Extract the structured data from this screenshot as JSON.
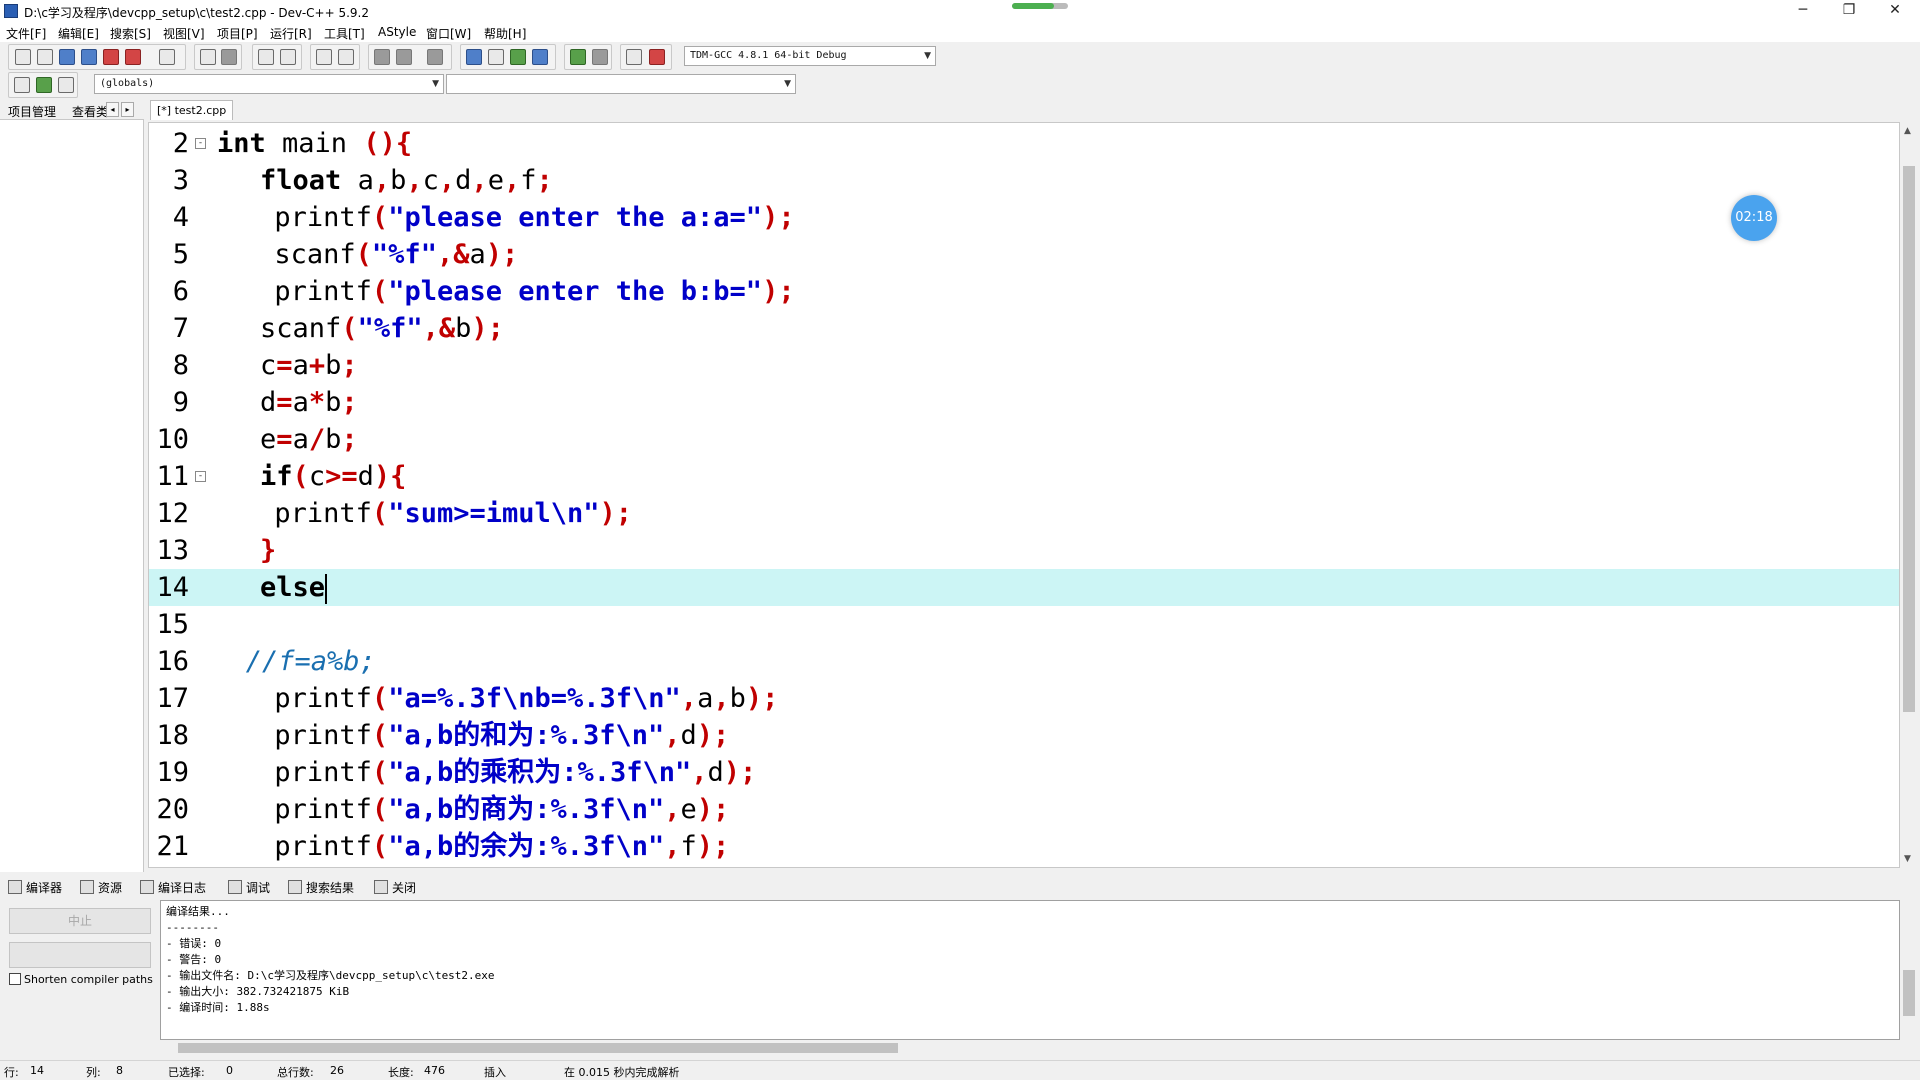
{
  "window": {
    "title": "D:\\c学习及程序\\devcpp_setup\\c\\test2.cpp - Dev-C++ 5.9.2",
    "progress_fraction": 0.75,
    "minimize": "─",
    "restore": "❐",
    "close": "✕"
  },
  "menu": [
    "文件[F]",
    "编辑[E]",
    "搜索[S]",
    "视图[V]",
    "项目[P]",
    "运行[R]",
    "工具[T]",
    "AStyle",
    "窗口[W]",
    "帮助[H]"
  ],
  "toolbar": {
    "compiler_select": "TDM-GCC 4.8.1 64-bit Debug",
    "scope_select": "(globals)",
    "symbol_select": ""
  },
  "left_panel": {
    "tab_project": "项目管理",
    "tab_view": "查看类",
    "arrow_left": "◂",
    "arrow_right": "▸"
  },
  "editor": {
    "tab_label": "[*] test2.cpp",
    "current_line": 14,
    "lines": [
      {
        "num": "2",
        "fold": "⊟",
        "indent": 0,
        "segs": [
          [
            "kw",
            "int"
          ],
          [
            "t",
            " main "
          ],
          [
            "sym",
            "(){"
          ]
        ]
      },
      {
        "num": "3",
        "indent": 3,
        "segs": [
          [
            "kw",
            "float"
          ],
          [
            "t",
            " a"
          ],
          [
            "sym",
            ","
          ],
          [
            "t",
            "b"
          ],
          [
            "sym",
            ","
          ],
          [
            "t",
            "c"
          ],
          [
            "sym",
            ","
          ],
          [
            "t",
            "d"
          ],
          [
            "sym",
            ","
          ],
          [
            "t",
            "e"
          ],
          [
            "sym",
            ","
          ],
          [
            "t",
            "f"
          ],
          [
            "sym",
            ";"
          ]
        ]
      },
      {
        "num": "4",
        "indent": 4,
        "segs": [
          [
            "t",
            "printf"
          ],
          [
            "sym",
            "("
          ],
          [
            "str",
            "\"please enter the a:a=\""
          ],
          [
            "sym",
            ");"
          ]
        ]
      },
      {
        "num": "5",
        "indent": 4,
        "segs": [
          [
            "t",
            "scanf"
          ],
          [
            "sym",
            "("
          ],
          [
            "str",
            "\"%f\""
          ],
          [
            "sym",
            ",&"
          ],
          [
            "t",
            "a"
          ],
          [
            "sym",
            ");"
          ]
        ]
      },
      {
        "num": "6",
        "indent": 4,
        "segs": [
          [
            "t",
            "printf"
          ],
          [
            "sym",
            "("
          ],
          [
            "str",
            "\"please enter the b:b=\""
          ],
          [
            "sym",
            ");"
          ]
        ]
      },
      {
        "num": "7",
        "indent": 3,
        "segs": [
          [
            "t",
            "scanf"
          ],
          [
            "sym",
            "("
          ],
          [
            "str",
            "\"%f\""
          ],
          [
            "sym",
            ",&"
          ],
          [
            "t",
            "b"
          ],
          [
            "sym",
            ");"
          ]
        ]
      },
      {
        "num": "8",
        "indent": 3,
        "segs": [
          [
            "t",
            "c"
          ],
          [
            "sym",
            "="
          ],
          [
            "t",
            "a"
          ],
          [
            "sym",
            "+"
          ],
          [
            "t",
            "b"
          ],
          [
            "sym",
            ";"
          ]
        ]
      },
      {
        "num": "9",
        "indent": 3,
        "segs": [
          [
            "t",
            "d"
          ],
          [
            "sym",
            "="
          ],
          [
            "t",
            "a"
          ],
          [
            "sym",
            "*"
          ],
          [
            "t",
            "b"
          ],
          [
            "sym",
            ";"
          ]
        ]
      },
      {
        "num": "10",
        "indent": 3,
        "segs": [
          [
            "t",
            "e"
          ],
          [
            "sym",
            "="
          ],
          [
            "t",
            "a"
          ],
          [
            "sym",
            "/"
          ],
          [
            "t",
            "b"
          ],
          [
            "sym",
            ";"
          ]
        ]
      },
      {
        "num": "11",
        "fold": "⊟",
        "indent": 3,
        "segs": [
          [
            "kw",
            "if"
          ],
          [
            "sym",
            "("
          ],
          [
            "t",
            "c"
          ],
          [
            "sym",
            ">="
          ],
          [
            "t",
            "d"
          ],
          [
            "sym",
            "){"
          ]
        ]
      },
      {
        "num": "12",
        "indent": 4,
        "segs": [
          [
            "t",
            "printf"
          ],
          [
            "sym",
            "("
          ],
          [
            "str",
            "\"sum>=imul\\n\""
          ],
          [
            "sym",
            ");"
          ]
        ]
      },
      {
        "num": "13",
        "indent": 3,
        "segs": [
          [
            "sym",
            "}"
          ]
        ]
      },
      {
        "num": "14",
        "indent": 3,
        "segs": [
          [
            "kw",
            "else"
          ]
        ],
        "caret": true
      },
      {
        "num": "15",
        "indent": 0,
        "segs": []
      },
      {
        "num": "16",
        "indent": 2,
        "segs": [
          [
            "cmt",
            "//f=a%b;"
          ]
        ]
      },
      {
        "num": "17",
        "indent": 4,
        "segs": [
          [
            "t",
            "printf"
          ],
          [
            "sym",
            "("
          ],
          [
            "str",
            "\"a=%.3f\\nb=%.3f\\n\""
          ],
          [
            "sym",
            ","
          ],
          [
            "t",
            "a"
          ],
          [
            "sym",
            ","
          ],
          [
            "t",
            "b"
          ],
          [
            "sym",
            ");"
          ]
        ]
      },
      {
        "num": "18",
        "indent": 4,
        "segs": [
          [
            "t",
            "printf"
          ],
          [
            "sym",
            "("
          ],
          [
            "str",
            "\"a,b的和为:%.3f\\n\""
          ],
          [
            "sym",
            ","
          ],
          [
            "t",
            "d"
          ],
          [
            "sym",
            ");"
          ]
        ]
      },
      {
        "num": "19",
        "indent": 4,
        "segs": [
          [
            "t",
            "printf"
          ],
          [
            "sym",
            "("
          ],
          [
            "str",
            "\"a,b的乘积为:%.3f\\n\""
          ],
          [
            "sym",
            ","
          ],
          [
            "t",
            "d"
          ],
          [
            "sym",
            ");"
          ]
        ]
      },
      {
        "num": "20",
        "indent": 4,
        "segs": [
          [
            "t",
            "printf"
          ],
          [
            "sym",
            "("
          ],
          [
            "str",
            "\"a,b的商为:%.3f\\n\""
          ],
          [
            "sym",
            ","
          ],
          [
            "t",
            "e"
          ],
          [
            "sym",
            ");"
          ]
        ]
      },
      {
        "num": "21",
        "indent": 4,
        "segs": [
          [
            "t",
            "printf"
          ],
          [
            "sym",
            "("
          ],
          [
            "str",
            "\"a,b的余为:%.3f\\n\""
          ],
          [
            "sym",
            ","
          ],
          [
            "t",
            "f"
          ],
          [
            "sym",
            ");"
          ]
        ]
      }
    ]
  },
  "timer_badge": "02:18",
  "bottom_tabs": [
    "编译器",
    "资源",
    "编译日志",
    "调试",
    "搜索结果",
    "关闭"
  ],
  "bottom_left": {
    "abort_button": "中止",
    "shorten_label": "Shorten compiler paths"
  },
  "compile_log": [
    "编译结果...",
    "--------",
    "- 错误: 0",
    "- 警告: 0",
    "- 输出文件名: D:\\c学习及程序\\devcpp_setup\\c\\test2.exe",
    "- 输出大小: 382.732421875 KiB",
    "- 编译时间: 1.88s"
  ],
  "status": {
    "row_label": "行:",
    "row_value": "14",
    "col_label": "列:",
    "col_value": "8",
    "sel_label": "已选择:",
    "sel_value": "0",
    "total_label": "总行数:",
    "total_value": "26",
    "len_label": "长度:",
    "len_value": "476",
    "mode": "插入",
    "parse_msg": "在 0.015 秒内完成解析"
  },
  "colors": {
    "current_line": "#ccf5f5",
    "symbol": "#c00000",
    "string": "#0000c8",
    "comment": "#1a6fb0",
    "badge": "#4aa3ee"
  }
}
